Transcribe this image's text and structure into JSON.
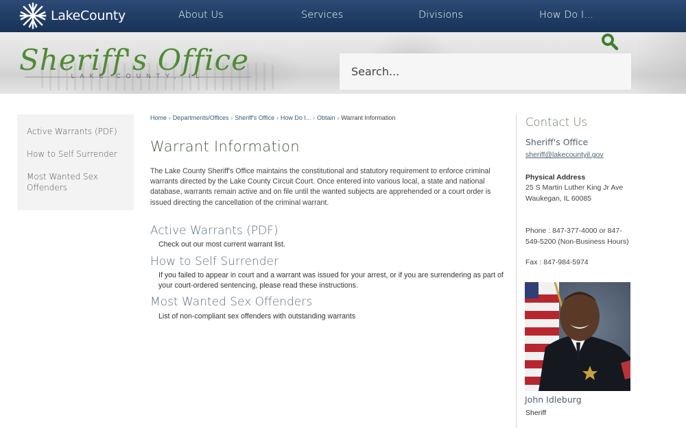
{
  "header": {
    "logo_text": "LakeCounty",
    "logo_icon": "snowflake-star-icon",
    "nav": [
      {
        "label": "About Us"
      },
      {
        "label": "Services"
      },
      {
        "label": "Divisions"
      },
      {
        "label": "How Do I..."
      }
    ]
  },
  "banner": {
    "title": "Sheriff's Office",
    "subtitle": "LAKE COUNTY, IL",
    "search": {
      "placeholder": "Search...",
      "value": "",
      "icon": "search-icon"
    }
  },
  "sidebar": {
    "items": [
      {
        "label": "Active Warrants (PDF)"
      },
      {
        "label": "How to Self Surrender"
      },
      {
        "label": "Most Wanted Sex Offenders"
      }
    ]
  },
  "breadcrumb": {
    "items": [
      "Home",
      "Departments/Offices",
      "Sheriff's Office",
      "How Do I...",
      "Obtain"
    ],
    "current": "Warrant Information",
    "separator": "›"
  },
  "main": {
    "title": "Warrant Information",
    "intro": "The Lake County Sheriff's Office maintains the constitutional and statutory requirement to enforce criminal warrants directed by the Lake County Circuit Court. Once entered into various local, a state and national database, warrants remain active and on file until the wanted subjects are apprehended or a court order is issued directing the cancellation of the criminal warrant.",
    "sections": [
      {
        "heading": "Active Warrants (PDF)",
        "description": "Check out our most current warrant list."
      },
      {
        "heading": "How to Self Surrender",
        "description": "If you failed to appear in court and a warrant was issued for your arrest, or if you are surrendering as part of your court-ordered sentencing, please read these instructions."
      },
      {
        "heading": "Most Wanted Sex Offenders",
        "description": "List of non-compliant sex offenders with outstanding warrants"
      }
    ]
  },
  "contact": {
    "title": "Contact Us",
    "org": "Sheriff's Office",
    "email": "sheriff@lakecountyil.gov",
    "address_label": "Physical Address",
    "address_line1": "25 S Martin Luther King Jr Ave",
    "address_line2": "Waukegan, IL 60085",
    "phone": "Phone : 847-377-4000 or 847-549-5200 (Non-Business Hours)",
    "fax": "Fax : 847-984-5974",
    "person_name": "John Idleburg",
    "person_role": "Sheriff"
  },
  "colors": {
    "nav_bg": "#1f3b63",
    "brand_green": "#4f8a33",
    "link_blue": "#4f6272",
    "sidebar_bg": "#f3f3f3"
  }
}
